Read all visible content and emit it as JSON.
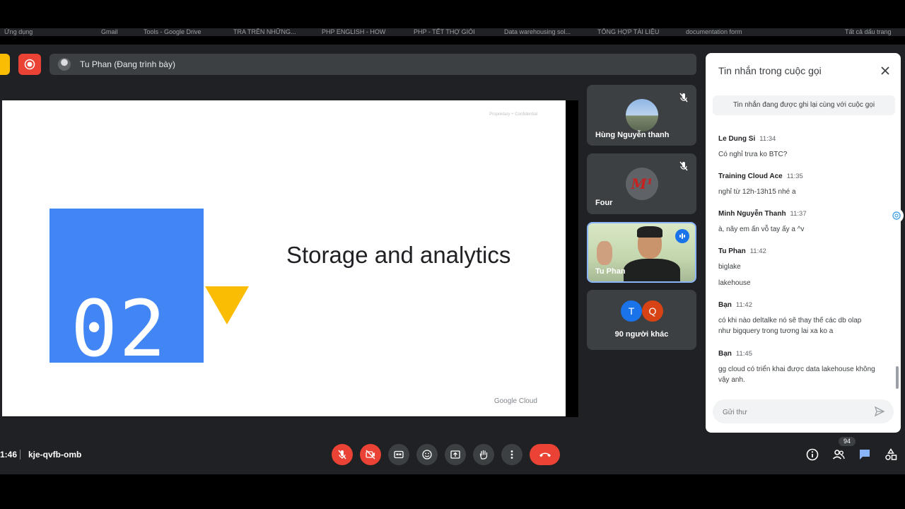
{
  "bookmarks": [
    "Ứng dụng",
    "",
    "",
    "Gmail",
    "Tools - Google Drive",
    "TRA TRÊN NHỮNG...",
    "PHP ENGLISH - HOW",
    "PHP - TẾT THỢ GIỎI",
    "Data warehousing sol...",
    "TỔNG HỢP TÀI LIỆU",
    "documentation form",
    "Tất cả dấu trang"
  ],
  "presenter": {
    "label": "Tu Phan (Đang trình bày)"
  },
  "slide": {
    "proprietary": "Proprietary + Confidential",
    "number": "02",
    "title": "Storage and analytics",
    "brand": "Google Cloud"
  },
  "participants": [
    {
      "name": "Hùng Nguyễn thanh",
      "muted": true
    },
    {
      "name": "Four",
      "muted": true,
      "avatar_text": "M¹"
    },
    {
      "name": "Tu Phan",
      "speaking": true
    }
  ],
  "others": {
    "avatars": [
      "T",
      "Q"
    ],
    "label": "90 người khác",
    "colors": [
      "#1a73e8",
      "#d84315"
    ]
  },
  "chat": {
    "title": "Tin nhắn trong cuộc gọi",
    "note": "Tin nhắn đang được ghi lại cùng với cuộc gọi",
    "messages": [
      {
        "sender": "Le Dung Si",
        "time": "11:34",
        "lines": [
          "Có nghỉ trưa ko BTC?"
        ]
      },
      {
        "sender": "Training Cloud Ace",
        "time": "11:35",
        "lines": [
          "nghỉ từ 12h-13h15 nhé a"
        ]
      },
      {
        "sender": "Minh Nguyễn Thanh",
        "time": "11:37",
        "lines": [
          "à, nãy em ấn vỗ tay ấy a ^v"
        ]
      },
      {
        "sender": "Tu Phan",
        "time": "11:42",
        "lines": [
          "biglake",
          "lakehouse"
        ]
      },
      {
        "sender": "Bạn",
        "time": "11:42",
        "lines": [
          "có khi nào deltalke nó sẽ thay thế các db olap như bigquery trong tương lai xa ko a"
        ]
      },
      {
        "sender": "Bạn",
        "time": "11:45",
        "lines": [
          "gg cloud có triển khai được data lakehouse không vậy anh."
        ]
      }
    ],
    "input_placeholder": "Gửi thư"
  },
  "footer": {
    "time": "1:46",
    "meeting_code": "kje-qvfb-omb",
    "people_count": "94"
  },
  "colors": {
    "accent": "#1a73e8",
    "danger": "#ea4335",
    "surface": "#3c4043",
    "background": "#202124"
  }
}
